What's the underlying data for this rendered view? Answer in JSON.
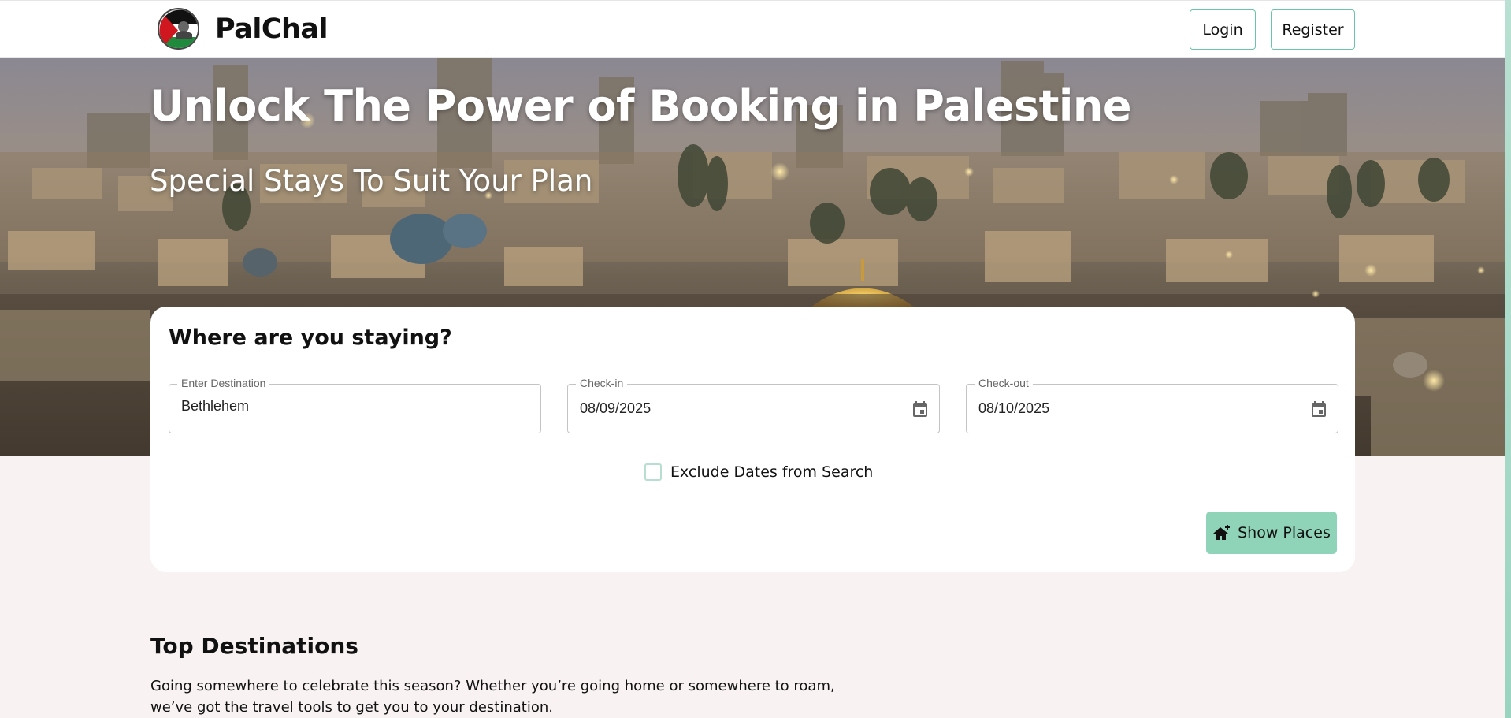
{
  "navbar": {
    "brand_name": "PalChal",
    "login_label": "Login",
    "register_label": "Register"
  },
  "hero": {
    "title": "Unlock The Power of Booking in Palestine",
    "subtitle": "Special Stays To Suit Your Plan"
  },
  "search": {
    "title": "Where are you staying?",
    "destination": {
      "label": "Enter Destination",
      "value": "Bethlehem"
    },
    "checkin": {
      "label": "Check-in",
      "value": "08/09/2025"
    },
    "checkout": {
      "label": "Check-out",
      "value": "08/10/2025"
    },
    "exclude_dates_label": "Exclude Dates from Search",
    "exclude_dates_checked": false,
    "show_places_label": "Show Places"
  },
  "top_destinations": {
    "title": "Top Destinations",
    "description": "Going somewhere to celebrate this season? Whether you’re going home or somewhere to roam, we’ve got the travel tools to get you to your destination."
  },
  "colors": {
    "accent": "#8fd3b8",
    "accent_border": "#6cc4a8",
    "page_background": "#f8f3f2"
  },
  "icons": {
    "checkin": "calendar-icon",
    "checkout": "calendar-icon",
    "show_places": "house-add-icon",
    "logo": "palestine-flag-logo-icon"
  }
}
